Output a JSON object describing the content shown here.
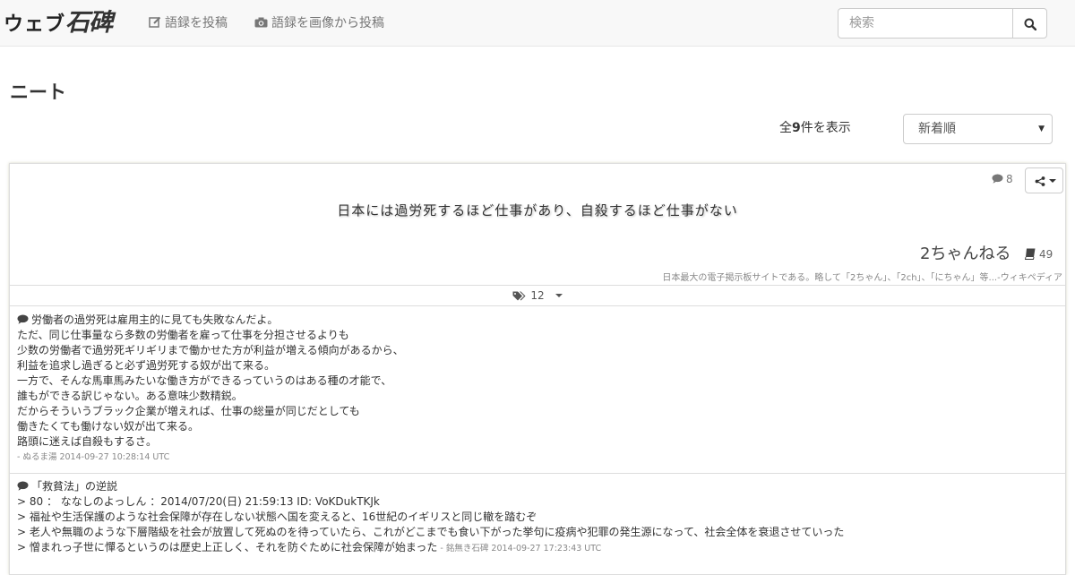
{
  "nav": {
    "brand_kana": "ウェブ",
    "brand_kanji": "石碑",
    "post_label": "語録を投稿",
    "post_image_label": "語録を画像から投稿",
    "search_placeholder": "検索"
  },
  "page": {
    "title": "ニート",
    "count_prefix": "全",
    "count_value": "9",
    "count_suffix": "件を表示",
    "sort_selected": "新着順"
  },
  "card": {
    "comment_count": "8",
    "quote": "日本には過労死するほど仕事があり、自殺するほど仕事がない",
    "source": "2ちゃんねる",
    "book_count": "49",
    "source_desc": "日本最大の電子掲示板サイトである。略して「2ちゃん」、「2ch」、「にちゃん」等...-ウィキペディア",
    "tag_count": "12"
  },
  "comments": [
    {
      "lines": [
        "労働者の過労死は雇用主的に見ても失敗なんだよ。",
        "ただ、同じ仕事量なら多数の労働者を雇って仕事を分担させるよりも",
        "少数の労働者で過労死ギリギリまで働かせた方が利益が増える傾向があるから、",
        "利益を追求し過ぎると必ず過労死する奴が出て来る。",
        "一方で、そんな馬車馬みたいな働き方ができるっていうのはある種の才能で、",
        "誰もができる訳じゃない。ある意味少数精鋭。",
        "だからそういうブラック企業が増えれば、仕事の総量が同じだとしても",
        "働きたくても働けない奴が出て来る。",
        "路頭に迷えば自殺もするさ。"
      ],
      "meta": "- ぬるま湯 2014-09-27 10:28:14 UTC"
    },
    {
      "lines": [
        "「救貧法」の逆説",
        "> 80 ： ななしのよっしん ：2014/07/20(日) 21:59:13 ID: VoKDukTKJk",
        "> 福祉や生活保護のような社会保障が存在しない状態へ国を変えると、16世紀のイギリスと同じ轍を踏むぞ",
        "> 老人や無職のような下層階級を社会が放置して死ぬのを待っていたら、これがどこまでも食い下がった挙句に疫病や犯罪の発生源になって、社会全体を衰退させていった",
        "> 憎まれっ子世に憚るというのは歴史上正しく、それを防ぐために社会保障が始まった"
      ],
      "meta": " - 銘無き石碑 2014-09-27 17:23:43 UTC"
    }
  ]
}
